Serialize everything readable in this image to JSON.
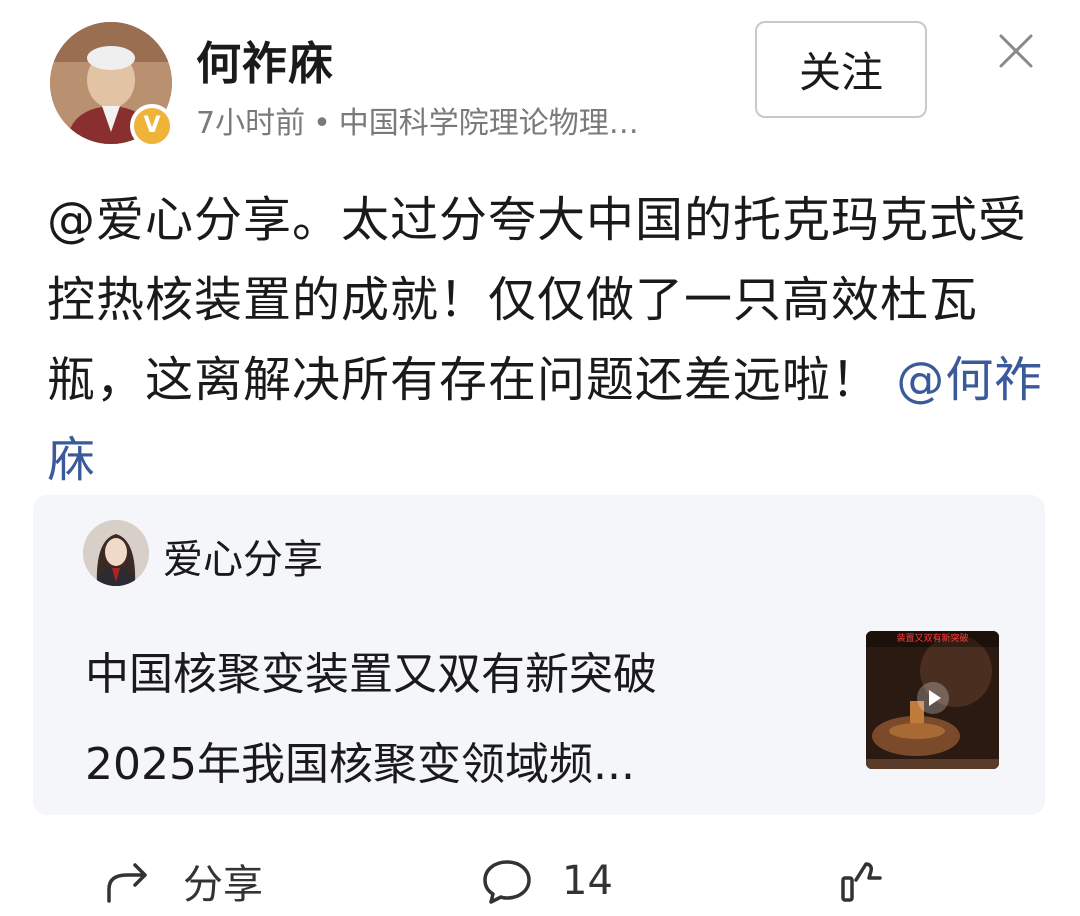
{
  "header": {
    "author_name": "何祚庥",
    "time_ago": "7小时前",
    "separator": "•",
    "affiliation": "中国科学院理论物理…",
    "follow_label": "关注",
    "verified_mark": "V"
  },
  "post": {
    "mention_source": "@爱心分享",
    "body": "。太过分夸大中国的托克玛克式受控热核装置的成就！仅仅做了一只高效杜瓦瓶，这离解决所有存在问题还差远啦！",
    "mention_target": "@何祚庥"
  },
  "quote": {
    "author_name": "爱心分享",
    "title_line1": "中国核聚变装置又双有新突破",
    "title_line2": "2025年我国核聚变领域频...",
    "thumb_caption": "装置又双有新突破"
  },
  "actions": {
    "share_label": "分享",
    "comment_count": "14"
  },
  "colors": {
    "mention": "#3a5a9a",
    "verified": "#f0b33a",
    "card_bg": "#f4f6fa"
  }
}
